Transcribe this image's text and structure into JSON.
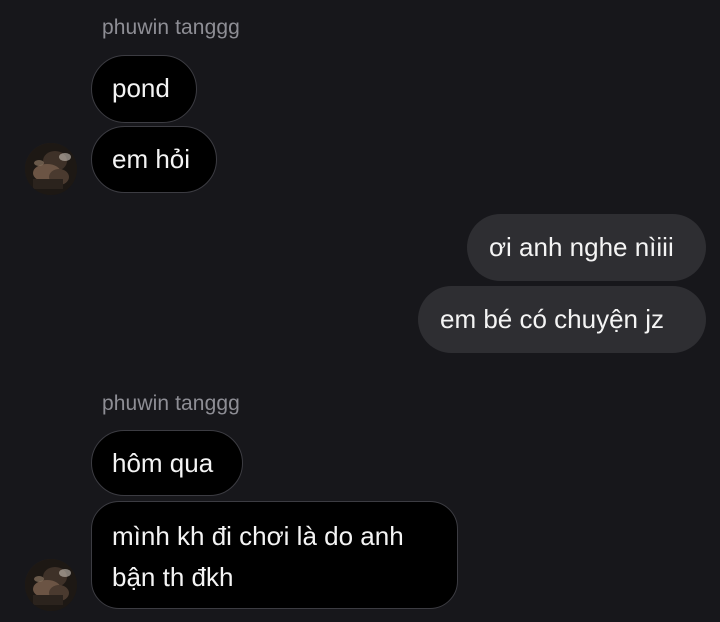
{
  "thread": {
    "groups": [
      {
        "sender": "phuwin tanggg",
        "messages": [
          "pond",
          "em hỏi"
        ]
      },
      {
        "outgoing": [
          "ơi anh nghe nìiii",
          "em bé có chuyện jz"
        ]
      },
      {
        "sender": "phuwin tanggg",
        "messages": [
          "hôm qua",
          "mình kh đi chơi là do anh bận th đkh"
        ]
      }
    ]
  },
  "colors": {
    "background": "#17171b",
    "incoming_bubble": "#000000",
    "outgoing_bubble": "#2e2e32",
    "sender_name": "#8e8e95"
  },
  "icons": {
    "avatar": "profile-photo"
  }
}
